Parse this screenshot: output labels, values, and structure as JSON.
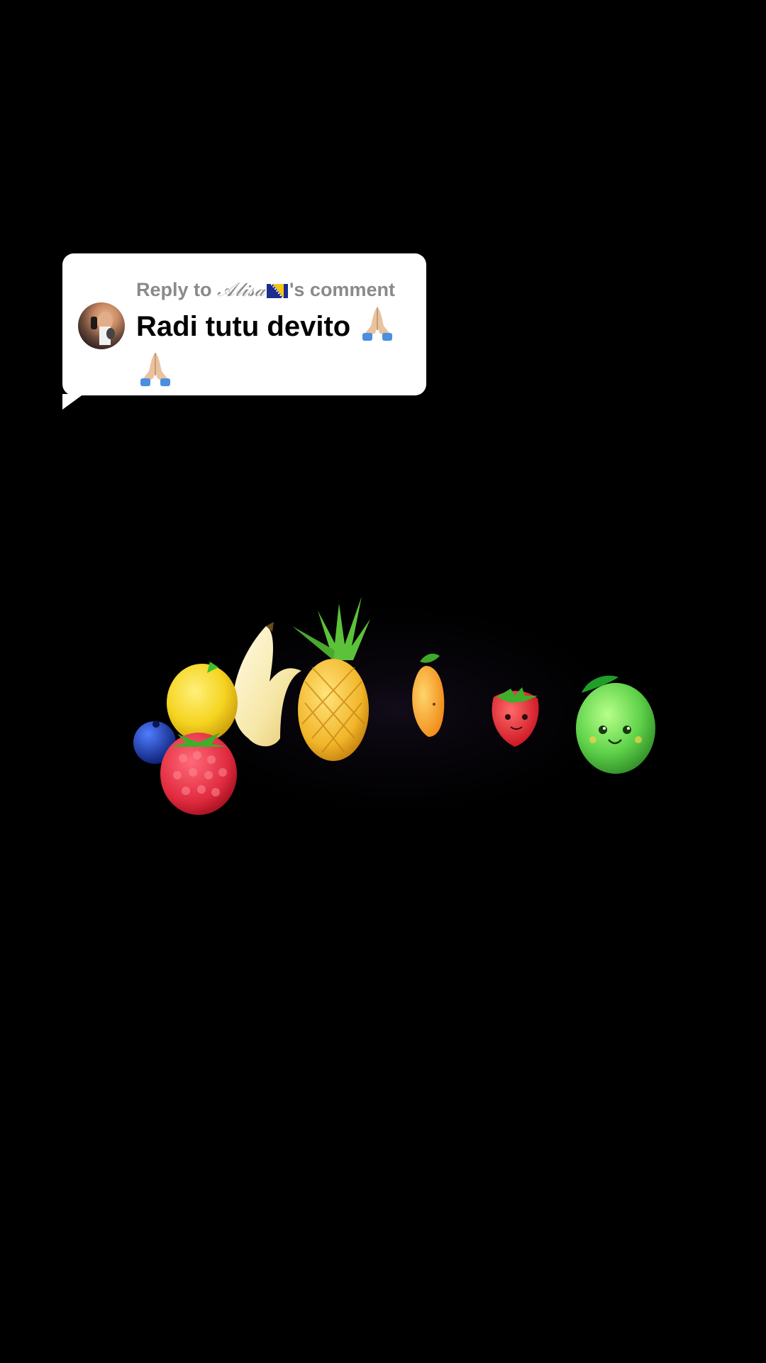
{
  "reply": {
    "prefix": "Reply to ",
    "username": "𝒜𝓁𝒾𝓈𝒶",
    "suffix": "'s comment",
    "comment": "Radi tutu devito",
    "flag_icon": "bosnia-flag-icon",
    "emoji_icon": "praying-hands-emoji"
  },
  "colors": {
    "background": "#000000",
    "bubble": "#ffffff",
    "reply_text": "#8a8a8a",
    "comment_text": "#000000"
  },
  "scene": {
    "fruits": [
      "blueberry",
      "lemon",
      "raspberry",
      "banana",
      "pineapple",
      "orange-slice",
      "strawberry",
      "lime"
    ]
  }
}
